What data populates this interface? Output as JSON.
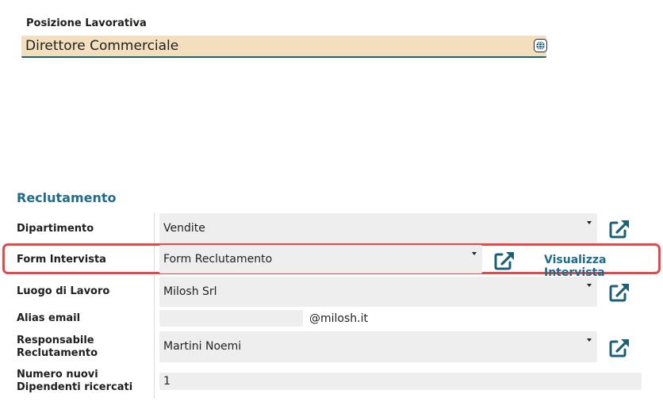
{
  "job_position": {
    "label": "Posizione Lavorativa",
    "value": "Direttore Commerciale"
  },
  "recruitment": {
    "title": "Reclutamento",
    "department": {
      "label": "Dipartimento",
      "value": "Vendite"
    },
    "interview_form": {
      "label": "Form Intervista",
      "value": "Form Reclutamento",
      "link": "Visualizza Intervista"
    },
    "work_location": {
      "label": "Luogo di Lavoro",
      "value": "Milosh Srl"
    },
    "email_alias": {
      "label": "Alias email",
      "value": "",
      "suffix": "@milosh.it"
    },
    "recruiter": {
      "label_line1": "Responsabile",
      "label_line2": "Reclutamento",
      "value": "Martini Noemi"
    },
    "target_hires": {
      "label_line1": "Numero nuovi",
      "label_line2": "Dipendenti ricercati",
      "value": "1"
    }
  },
  "colors": {
    "accent": "#1e6c8a",
    "highlight": "#e5484a",
    "position_field_bg": "#f3dfbe",
    "field_bg": "#eeeeee"
  },
  "icons": [
    "globe-icon",
    "external-link-icon",
    "dropdown-caret-icon"
  ]
}
